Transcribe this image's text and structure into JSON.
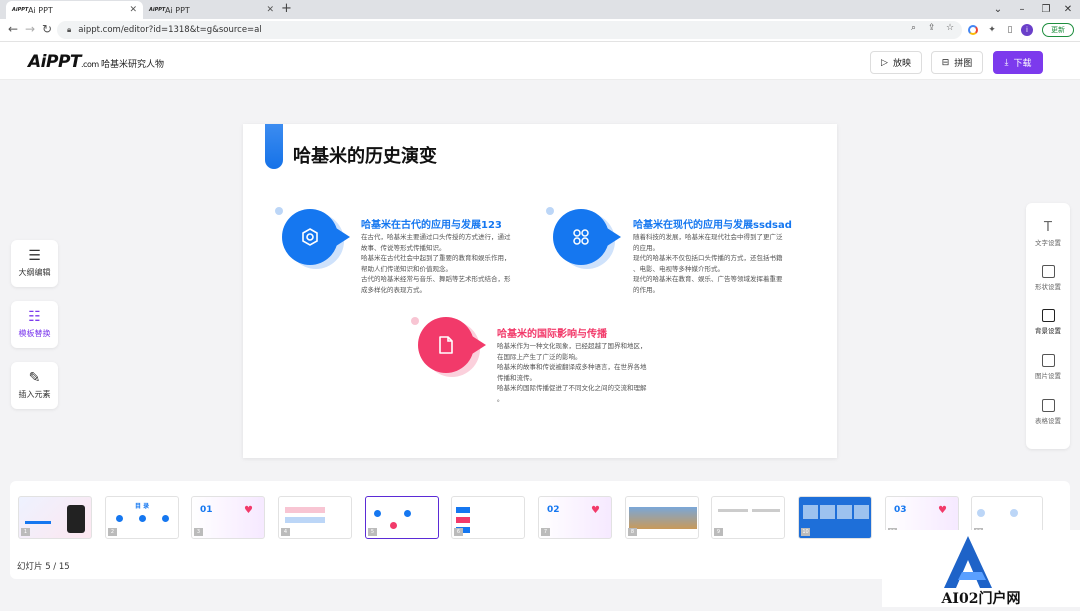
{
  "browser": {
    "tabs": [
      {
        "label": "Ai PPT",
        "favicon": "AiPPT"
      },
      {
        "label": "Ai PPT",
        "favicon": "AiPPT"
      }
    ],
    "url": "aippt.com/editor?id=1318&t=g&source=al",
    "update_label": "更新"
  },
  "header": {
    "logo_main": "AiPPT",
    "logo_suffix": ".com",
    "doc_title": "哈基米研究人物",
    "play_label": "放映",
    "collage_label": "拼图",
    "download_label": "下载"
  },
  "left_tools": [
    {
      "label": "大纲编辑",
      "icon": "outline-icon"
    },
    {
      "label": "模板替换",
      "icon": "template-icon"
    },
    {
      "label": "插入元素",
      "icon": "insert-icon"
    }
  ],
  "right_tools": [
    {
      "label": "文字设置",
      "icon": "text-icon"
    },
    {
      "label": "形状设置",
      "icon": "shape-icon"
    },
    {
      "label": "背景设置",
      "icon": "background-icon"
    },
    {
      "label": "图片设置",
      "icon": "image-icon"
    },
    {
      "label": "表格设置",
      "icon": "table-icon"
    }
  ],
  "slide": {
    "title": "哈基米的历史演变",
    "items": [
      {
        "title": "哈基米在古代的应用与发展123",
        "icon": "hexagon-gear-icon",
        "color": "#1577f0",
        "lines": [
          "在古代，哈基米主要通过口头传授的方式进行，通过",
          "故事、传说等形式传播知识。",
          "哈基米在古代社会中起到了重要的教育和娱乐作用，",
          "帮助人们传递知识和价值观念。",
          "古代的哈基米经常与音乐、舞蹈等艺术形式结合，形",
          "成多样化的表现方式。"
        ]
      },
      {
        "title": "哈基米在现代的应用与发展ssdsad",
        "icon": "grid-icon",
        "color": "#1577f0",
        "lines": [
          "随着科技的发展，哈基米在现代社会中得到了更广泛",
          "的应用。",
          "现代的哈基米不仅包括口头传播的方式，还包括书籍",
          "、电影、电视等多种媒介形式。",
          "现代的哈基米在教育、娱乐、广告等领域发挥着重要",
          "的作用。"
        ]
      },
      {
        "title": "哈基米的国际影响与传播",
        "icon": "document-icon",
        "color": "#f23a6a",
        "lines": [
          "哈基米作为一种文化现象，已经超越了国界和地区，",
          "在国际上产生了广泛的影响。",
          "哈基米的故事和传说被翻译成多种语言，在世界各地",
          "传播和流传。",
          "哈基米的国际传播促进了不同文化之间的交流和理解",
          "。"
        ]
      }
    ]
  },
  "thumbnails": [
    {
      "num": "1",
      "kind": "cover"
    },
    {
      "num": "2",
      "kind": "toc"
    },
    {
      "num": "3",
      "kind": "section",
      "big": "01"
    },
    {
      "num": "4",
      "kind": "content"
    },
    {
      "num": "5",
      "kind": "content-active"
    },
    {
      "num": "6",
      "kind": "content"
    },
    {
      "num": "7",
      "kind": "section",
      "big": "02"
    },
    {
      "num": "8",
      "kind": "photo"
    },
    {
      "num": "9",
      "kind": "content"
    },
    {
      "num": "10",
      "kind": "photos"
    },
    {
      "num": "11",
      "kind": "section",
      "big": "03"
    },
    {
      "num": "12",
      "kind": "content"
    }
  ],
  "toc_label": "目 录",
  "counter": "幻灯片  5 / 15"
}
